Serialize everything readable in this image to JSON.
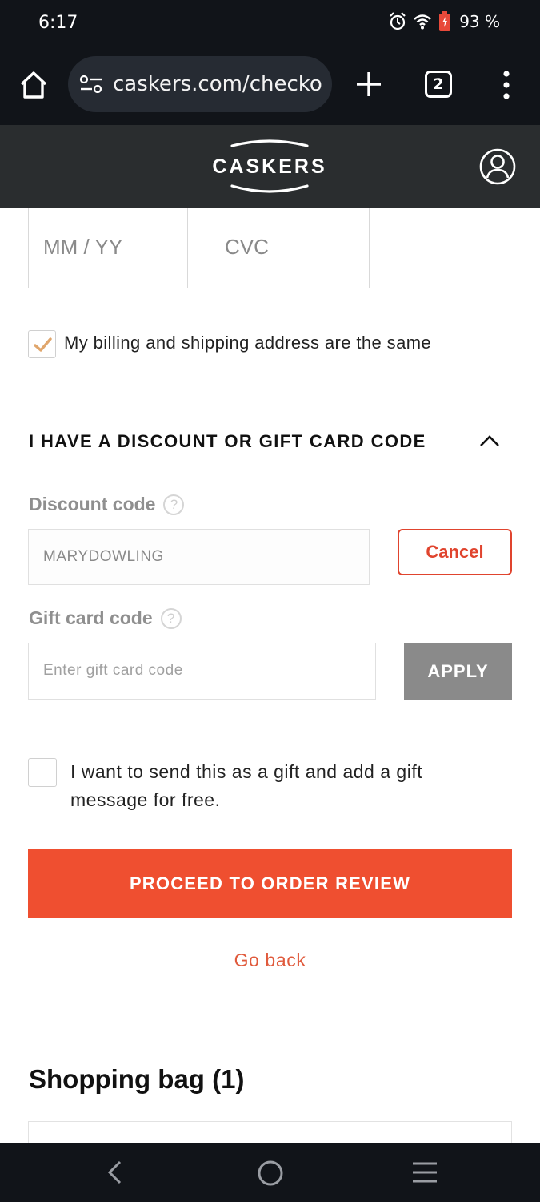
{
  "status_bar": {
    "time": "6:17",
    "battery": "93 %"
  },
  "browser": {
    "url": "caskers.com/checko",
    "tab_count": "2"
  },
  "site": {
    "logo_text": "CASKERS"
  },
  "payment": {
    "expiry_placeholder": "MM / YY",
    "cvc_placeholder": "CVC"
  },
  "billing": {
    "same_address_label": "My billing and shipping address are the same",
    "same_address_checked": true
  },
  "discount_section": {
    "title": "I HAVE A DISCOUNT OR GIFT CARD CODE",
    "discount_label": "Discount code",
    "discount_value": "MARYDOWLING",
    "cancel_label": "Cancel",
    "gift_label": "Gift card code",
    "gift_placeholder": "Enter gift card code",
    "apply_label": "APPLY",
    "help_glyph": "?"
  },
  "gift": {
    "message_label": "I want to send this as a gift and add a gift message for free.",
    "checked": false
  },
  "actions": {
    "proceed_label": "PROCEED TO ORDER REVIEW",
    "back_label": "Go back"
  },
  "bag": {
    "title": "Shopping bag (1)"
  },
  "colors": {
    "accent": "#ef4f30",
    "checkmark": "#e0a66c",
    "header_bg": "#2a2d2f",
    "system_bg": "#111419"
  }
}
